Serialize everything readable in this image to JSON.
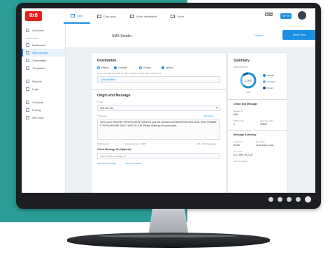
{
  "colors": {
    "accent": "#1b8fe0",
    "brand": "#e2231a",
    "teal_bg": "#2a9d96"
  },
  "app": {
    "logo": "8x8"
  },
  "tabs": [
    {
      "label": "SMS",
      "icon": "send-icon"
    },
    {
      "label": "Chat apps",
      "icon": "chat-icon"
    },
    {
      "label": "Video interactive",
      "icon": "video-icon"
    },
    {
      "label": "Voice",
      "icon": "phone-icon"
    }
  ],
  "account": {
    "balance_label": "Balance",
    "balance_value": "€392",
    "topup_label": "TOP UP"
  },
  "sidebar": {
    "overview": "Overview",
    "section_caption": "MESSAGING",
    "items": [
      "Dashboard",
      "SMS Sender",
      "Campaigns",
      "Templates"
    ],
    "items2": [
      "Reports",
      "Logs"
    ],
    "items3": [
      "Contacts",
      "Pricing",
      "API Keys"
    ]
  },
  "header": {
    "title": "SMS Sender",
    "cancel": "Cancel",
    "send": "Send Now"
  },
  "form": {
    "destination_title": "Destination",
    "radio_labels": [
      "Manual",
      "Contacts",
      "Groups",
      "Upload"
    ],
    "helper": "Type a number to search for your contacts or enter new number here",
    "chip": "+65 94022803",
    "origin_title": "Origin and Message",
    "from_label": "* From",
    "from_value": "Sub Acc No.",
    "message_label": "* Message",
    "add_field": "Add Fields",
    "message_text": "Here is your SECRET VERIFICATION CODE for your SG JUB account REGISTRATION: 5278. DON'T SHARE IT WITH ANYONE DIVE CARE SG JUB. Please share go.sb.com/nuzlen",
    "sms_count": "SMS Count: 1",
    "encoding": "Encoding Type: GSM7",
    "char_count": "158 / 160 Characters",
    "client_ref_label": "Client Message ID (Optional)",
    "client_ref_placeholder": "Input client message id",
    "link1": "Schedule Campaign",
    "link2": "Save as template"
  },
  "summary": {
    "title": "Summary",
    "destination_label": "DESTINATION",
    "donut_value": "1,055",
    "donut_caption": "Total",
    "legend": [
      "Manual",
      "Contacts",
      "Group"
    ],
    "segments": [
      0.62,
      0.25,
      0.13
    ],
    "origin_title": "Origin and Message",
    "sender_label": "Sender ID",
    "sender_value": "8x8",
    "sms_count_label": "SMS Count",
    "sms_count_value": "1",
    "encoding_label": "Encoding Type",
    "encoding_value": "GSM7",
    "msg_summary_title": "Message Summary",
    "total_label": "Total Cost",
    "total_value": "€0.82",
    "run_time_label": "Run Time",
    "run_time_value": "Less than a min",
    "est_label": "Est. Cost",
    "est_value": "€ 0.7999 / € 2.19",
    "schedule_label": "SMS Schedule"
  }
}
